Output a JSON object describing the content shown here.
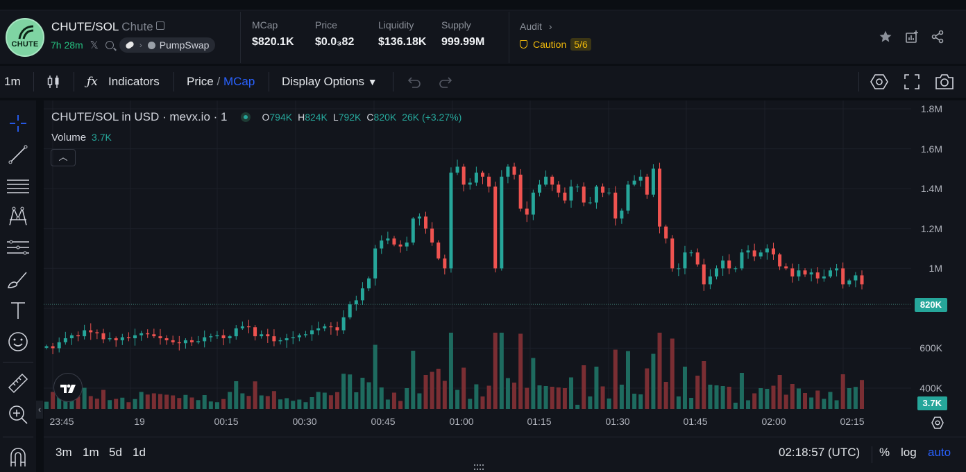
{
  "header": {
    "pair": "CHUTE/SOL",
    "name": "Chute",
    "logo_text": "CHUTE",
    "age": "7h 28m",
    "dex": "PumpSwap",
    "stats": [
      {
        "label": "MCap",
        "value": "$820.1K"
      },
      {
        "label": "Price",
        "value": "$0.0₃82"
      },
      {
        "label": "Liquidity",
        "value": "$136.18K"
      },
      {
        "label": "Supply",
        "value": "999.99M"
      }
    ],
    "audit": {
      "label": "Audit",
      "status": "Caution",
      "score": "5/6"
    }
  },
  "toolbar": {
    "interval": "1m",
    "indicators": "Indicators",
    "price": "Price",
    "slash": "/",
    "mcap": "MCap",
    "display_options": "Display Options"
  },
  "legend": {
    "title": "CHUTE/SOL in USD · mevx.io · 1",
    "ohlc": [
      {
        "k": "O",
        "v": "794K"
      },
      {
        "k": "H",
        "v": "824K"
      },
      {
        "k": "L",
        "v": "792K"
      },
      {
        "k": "C",
        "v": "820K"
      }
    ],
    "change": "26K (+3.27%)",
    "volume_label": "Volume",
    "volume_value": "3.7K"
  },
  "chart_data": {
    "type": "candlestick",
    "y_ticks": [
      "1.8M",
      "1.6M",
      "1.4M",
      "1.2M",
      "1M",
      "820K",
      "600K",
      "400K"
    ],
    "x_ticks": [
      "23:45",
      "19",
      "00:15",
      "00:30",
      "00:45",
      "01:00",
      "01:15",
      "01:30",
      "01:45",
      "02:00",
      "02:15"
    ],
    "last_price_label": "820K",
    "last_volume_label": "3.7K",
    "ylim": [
      400000,
      1800000
    ],
    "colors": {
      "up": "#26a69a",
      "down": "#ef5350"
    },
    "closes": [
      610,
      600,
      630,
      650,
      665,
      660,
      690,
      680,
      675,
      645,
      650,
      640,
      655,
      650,
      665,
      675,
      670,
      660,
      650,
      640,
      630,
      625,
      640,
      630,
      635,
      655,
      660,
      665,
      650,
      660,
      700,
      710,
      705,
      660,
      670,
      660,
      635,
      640,
      650,
      655,
      665,
      670,
      690,
      700,
      710,
      705,
      690,
      755,
      820,
      840,
      900,
      950,
      1100,
      1140,
      1150,
      1120,
      1110,
      1130,
      1250,
      1260,
      1200,
      1130,
      1050,
      1000,
      1480,
      1510,
      1420,
      1430,
      1480,
      1460,
      1410,
      1000,
      1460,
      1510,
      1470,
      1300,
      1270,
      1380,
      1420,
      1460,
      1420,
      1380,
      1340,
      1410,
      1410,
      1330,
      1330,
      1410,
      1380,
      1380,
      1250,
      1290,
      1420,
      1440,
      1460,
      1370,
      1500,
      1210,
      1150,
      1000,
      1000,
      1080,
      1080,
      1020,
      920,
      960,
      1000,
      1040,
      1000,
      1000,
      1080,
      1090,
      1060,
      1080,
      1100,
      1070,
      1010,
      1000,
      960,
      990,
      970,
      980,
      950,
      960,
      990,
      1000,
      920,
      940,
      965,
      920
    ]
  },
  "bottombar": {
    "ranges": [
      "3m",
      "1m",
      "5d",
      "1d"
    ],
    "time": "02:18:57 (UTC)",
    "percent": "%",
    "log": "log",
    "auto": "auto"
  }
}
